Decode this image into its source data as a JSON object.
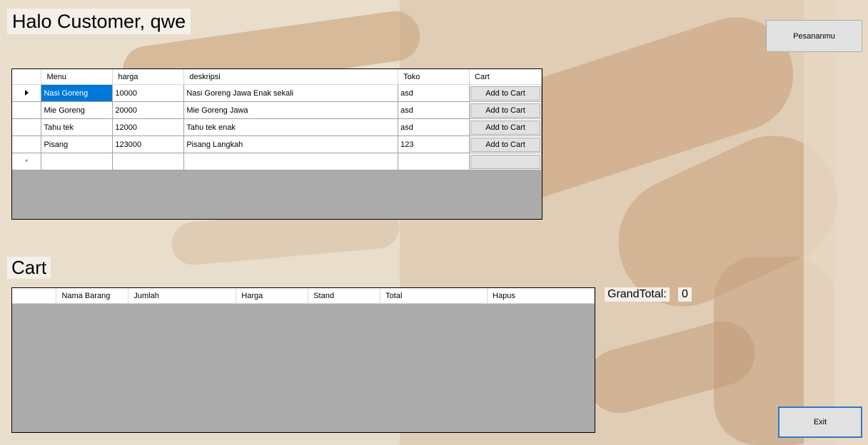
{
  "header": {
    "greeting": "Halo Customer, qwe"
  },
  "buttons": {
    "pesanan": "Pesananmu",
    "exit": "Exit"
  },
  "menu_table": {
    "columns": [
      "Menu",
      "harga",
      "deskripsi",
      "Toko",
      "Cart"
    ],
    "rows": [
      {
        "menu": "Nasi Goreng",
        "harga": "10000",
        "deskripsi": "Nasi Goreng Jawa Enak sekali",
        "toko": "asd",
        "cart": "Add to Cart"
      },
      {
        "menu": "Mie Goreng",
        "harga": "20000",
        "deskripsi": "Mie Goreng Jawa",
        "toko": "asd",
        "cart": "Add to Cart"
      },
      {
        "menu": "Tahu tek",
        "harga": "12000",
        "deskripsi": "Tahu tek enak",
        "toko": "asd",
        "cart": "Add to Cart"
      },
      {
        "menu": "Pisang",
        "harga": "123000",
        "deskripsi": "Pisang Langkah",
        "toko": "123",
        "cart": "Add to Cart"
      }
    ],
    "new_row_marker": "*"
  },
  "cart": {
    "title": "Cart",
    "columns": [
      "Nama Barang",
      "Jumlah",
      "Harga",
      "Stand",
      "Total",
      "Hapus"
    ],
    "grand_total_label": "GrandTotal:",
    "grand_total_value": "0"
  },
  "colors": {
    "selection": "#0078d7",
    "grid_background": "#ababab",
    "accent_border": "#2f78c8"
  }
}
